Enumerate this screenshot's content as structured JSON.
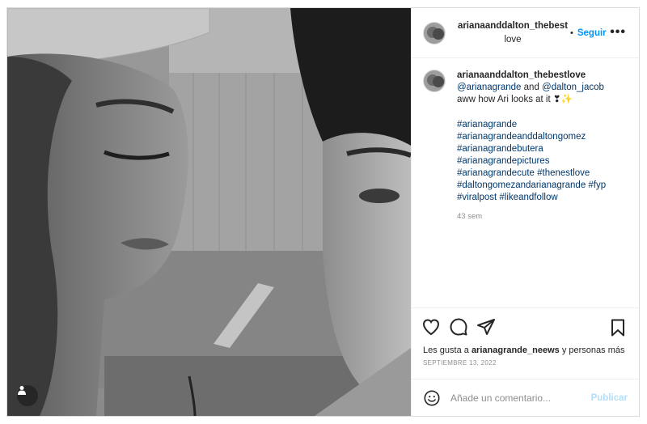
{
  "post": {
    "author": {
      "line1": "arianaanddalton_thebest",
      "line2": "love",
      "separator": "•",
      "follow_label": "Seguir",
      "more_label": "•••"
    },
    "caption": {
      "username": "arianaanddalton_thebestlove",
      "mention_line": {
        "mention1": "@arianagrande",
        "and": " and ",
        "mention2": "@dalton_jacob"
      },
      "text": "aww how Ari looks at it ❣✨",
      "hashtag_lines": [
        "#arianagrande",
        "#arianagrandeanddaltongomez",
        "#arianagrandebutera",
        "#arianagrandepictures",
        "#arianagrandecute #thenestlove",
        "#daltongomezandarianagrande #fyp",
        "#viralpost #likeandfollow"
      ],
      "time": "43 sem"
    },
    "likes": {
      "prefix": "Les gusta a ",
      "user": "arianagrande_neews",
      "suffix": " y personas más"
    },
    "date": "SEPTIEMBRE 13, 2022",
    "comment_box": {
      "placeholder": "Añade un comentario...",
      "publish_label": "Publicar"
    },
    "icons": [
      "heart-icon",
      "comment-icon",
      "share-icon",
      "bookmark-icon",
      "emoji-icon",
      "user-tag-icon",
      "more-options-icon"
    ]
  },
  "colors": {
    "link": "#0095f6",
    "hashtag": "#00376b",
    "muted": "#8e8e8e",
    "publish_disabled": "#b2dffc"
  }
}
